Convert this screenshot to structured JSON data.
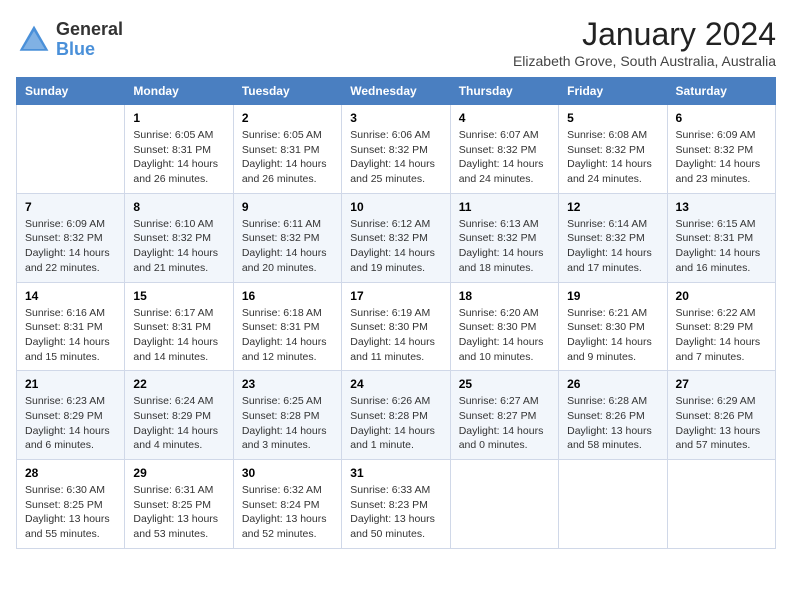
{
  "logo": {
    "general": "General",
    "blue": "Blue"
  },
  "title": "January 2024",
  "subtitle": "Elizabeth Grove, South Australia, Australia",
  "headers": [
    "Sunday",
    "Monday",
    "Tuesday",
    "Wednesday",
    "Thursday",
    "Friday",
    "Saturday"
  ],
  "weeks": [
    [
      {
        "day": "",
        "info": ""
      },
      {
        "day": "1",
        "info": "Sunrise: 6:05 AM\nSunset: 8:31 PM\nDaylight: 14 hours\nand 26 minutes."
      },
      {
        "day": "2",
        "info": "Sunrise: 6:05 AM\nSunset: 8:31 PM\nDaylight: 14 hours\nand 26 minutes."
      },
      {
        "day": "3",
        "info": "Sunrise: 6:06 AM\nSunset: 8:32 PM\nDaylight: 14 hours\nand 25 minutes."
      },
      {
        "day": "4",
        "info": "Sunrise: 6:07 AM\nSunset: 8:32 PM\nDaylight: 14 hours\nand 24 minutes."
      },
      {
        "day": "5",
        "info": "Sunrise: 6:08 AM\nSunset: 8:32 PM\nDaylight: 14 hours\nand 24 minutes."
      },
      {
        "day": "6",
        "info": "Sunrise: 6:09 AM\nSunset: 8:32 PM\nDaylight: 14 hours\nand 23 minutes."
      }
    ],
    [
      {
        "day": "7",
        "info": "Sunrise: 6:09 AM\nSunset: 8:32 PM\nDaylight: 14 hours\nand 22 minutes."
      },
      {
        "day": "8",
        "info": "Sunrise: 6:10 AM\nSunset: 8:32 PM\nDaylight: 14 hours\nand 21 minutes."
      },
      {
        "day": "9",
        "info": "Sunrise: 6:11 AM\nSunset: 8:32 PM\nDaylight: 14 hours\nand 20 minutes."
      },
      {
        "day": "10",
        "info": "Sunrise: 6:12 AM\nSunset: 8:32 PM\nDaylight: 14 hours\nand 19 minutes."
      },
      {
        "day": "11",
        "info": "Sunrise: 6:13 AM\nSunset: 8:32 PM\nDaylight: 14 hours\nand 18 minutes."
      },
      {
        "day": "12",
        "info": "Sunrise: 6:14 AM\nSunset: 8:32 PM\nDaylight: 14 hours\nand 17 minutes."
      },
      {
        "day": "13",
        "info": "Sunrise: 6:15 AM\nSunset: 8:31 PM\nDaylight: 14 hours\nand 16 minutes."
      }
    ],
    [
      {
        "day": "14",
        "info": "Sunrise: 6:16 AM\nSunset: 8:31 PM\nDaylight: 14 hours\nand 15 minutes."
      },
      {
        "day": "15",
        "info": "Sunrise: 6:17 AM\nSunset: 8:31 PM\nDaylight: 14 hours\nand 14 minutes."
      },
      {
        "day": "16",
        "info": "Sunrise: 6:18 AM\nSunset: 8:31 PM\nDaylight: 14 hours\nand 12 minutes."
      },
      {
        "day": "17",
        "info": "Sunrise: 6:19 AM\nSunset: 8:30 PM\nDaylight: 14 hours\nand 11 minutes."
      },
      {
        "day": "18",
        "info": "Sunrise: 6:20 AM\nSunset: 8:30 PM\nDaylight: 14 hours\nand 10 minutes."
      },
      {
        "day": "19",
        "info": "Sunrise: 6:21 AM\nSunset: 8:30 PM\nDaylight: 14 hours\nand 9 minutes."
      },
      {
        "day": "20",
        "info": "Sunrise: 6:22 AM\nSunset: 8:29 PM\nDaylight: 14 hours\nand 7 minutes."
      }
    ],
    [
      {
        "day": "21",
        "info": "Sunrise: 6:23 AM\nSunset: 8:29 PM\nDaylight: 14 hours\nand 6 minutes."
      },
      {
        "day": "22",
        "info": "Sunrise: 6:24 AM\nSunset: 8:29 PM\nDaylight: 14 hours\nand 4 minutes."
      },
      {
        "day": "23",
        "info": "Sunrise: 6:25 AM\nSunset: 8:28 PM\nDaylight: 14 hours\nand 3 minutes."
      },
      {
        "day": "24",
        "info": "Sunrise: 6:26 AM\nSunset: 8:28 PM\nDaylight: 14 hours\nand 1 minute."
      },
      {
        "day": "25",
        "info": "Sunrise: 6:27 AM\nSunset: 8:27 PM\nDaylight: 14 hours\nand 0 minutes."
      },
      {
        "day": "26",
        "info": "Sunrise: 6:28 AM\nSunset: 8:26 PM\nDaylight: 13 hours\nand 58 minutes."
      },
      {
        "day": "27",
        "info": "Sunrise: 6:29 AM\nSunset: 8:26 PM\nDaylight: 13 hours\nand 57 minutes."
      }
    ],
    [
      {
        "day": "28",
        "info": "Sunrise: 6:30 AM\nSunset: 8:25 PM\nDaylight: 13 hours\nand 55 minutes."
      },
      {
        "day": "29",
        "info": "Sunrise: 6:31 AM\nSunset: 8:25 PM\nDaylight: 13 hours\nand 53 minutes."
      },
      {
        "day": "30",
        "info": "Sunrise: 6:32 AM\nSunset: 8:24 PM\nDaylight: 13 hours\nand 52 minutes."
      },
      {
        "day": "31",
        "info": "Sunrise: 6:33 AM\nSunset: 8:23 PM\nDaylight: 13 hours\nand 50 minutes."
      },
      {
        "day": "",
        "info": ""
      },
      {
        "day": "",
        "info": ""
      },
      {
        "day": "",
        "info": ""
      }
    ]
  ]
}
